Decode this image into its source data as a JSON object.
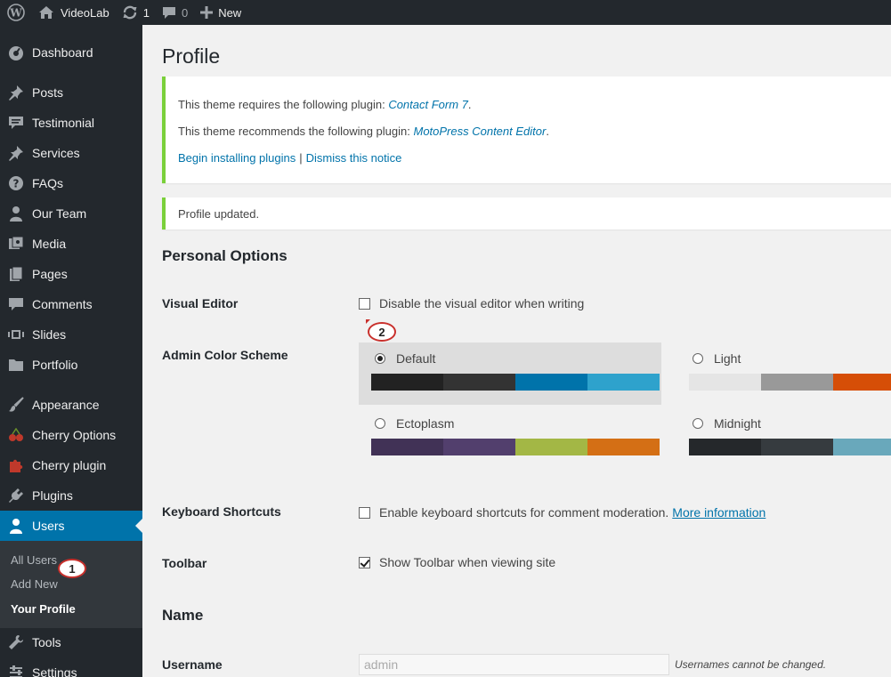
{
  "adminbar": {
    "site_name": "VideoLab",
    "updates_count": "1",
    "comments_count": "0",
    "new_label": "New",
    "icons": [
      "wordpress-logo-icon",
      "home-icon",
      "updates-icon",
      "comment-bubble-icon",
      "plus-icon"
    ]
  },
  "sidebar": {
    "items": [
      {
        "label": "Dashboard",
        "icon": "dashboard-icon"
      },
      {
        "label": "Posts",
        "icon": "pushpin-icon"
      },
      {
        "label": "Testimonial",
        "icon": "testimonial-icon"
      },
      {
        "label": "Services",
        "icon": "pushpin-icon"
      },
      {
        "label": "FAQs",
        "icon": "question-icon"
      },
      {
        "label": "Our Team",
        "icon": "person-icon"
      },
      {
        "label": "Media",
        "icon": "media-icon"
      },
      {
        "label": "Pages",
        "icon": "pages-icon"
      },
      {
        "label": "Comments",
        "icon": "comment-icon"
      },
      {
        "label": "Slides",
        "icon": "slides-icon"
      },
      {
        "label": "Portfolio",
        "icon": "folder-icon"
      },
      {
        "label": "Appearance",
        "icon": "brush-icon"
      },
      {
        "label": "Cherry Options",
        "icon": "cherry-icon"
      },
      {
        "label": "Cherry plugin",
        "icon": "puzzle-icon"
      },
      {
        "label": "Plugins",
        "icon": "plug-icon"
      },
      {
        "label": "Users",
        "icon": "user-icon"
      },
      {
        "label": "Tools",
        "icon": "wrench-icon"
      },
      {
        "label": "Settings",
        "icon": "settings-icon"
      }
    ],
    "submenu": [
      "All Users",
      "Add New",
      "Your Profile"
    ]
  },
  "main": {
    "title": "Profile",
    "notice_plugins": {
      "line1_prefix": "This theme requires the following plugin:",
      "line1_link": "Contact Form 7",
      "line2_prefix": "This theme recommends the following plugin:",
      "line2_link": "MotoPress Content Editor",
      "begin_link": "Begin installing plugins",
      "separator": "|",
      "dismiss_link": "Dismiss this notice"
    },
    "notice_updated": "Profile updated.",
    "personal_options": {
      "heading": "Personal Options",
      "visual_editor_label": "Visual Editor",
      "visual_editor_text": "Disable the visual editor when writing",
      "visual_editor_checked": false,
      "color_scheme_label": "Admin Color Scheme",
      "schemes": [
        {
          "name": "Default",
          "selected": true,
          "colors": [
            "#222222",
            "#333333",
            "#0073aa",
            "#2ea2cc"
          ]
        },
        {
          "name": "Light",
          "selected": false,
          "colors": [
            "#e5e5e5",
            "#999999",
            "#d64e07",
            "#04a4cc"
          ]
        },
        {
          "name": "Ectoplasm",
          "selected": false,
          "colors": [
            "#413256",
            "#523f6d",
            "#a3b745",
            "#d46f15"
          ]
        },
        {
          "name": "Midnight",
          "selected": false,
          "colors": [
            "#25282b",
            "#363b3f",
            "#69a8bb",
            "#e14d43"
          ]
        }
      ],
      "keyboard_label": "Keyboard Shortcuts",
      "keyboard_text": "Enable keyboard shortcuts for comment moderation.",
      "keyboard_link": "More information",
      "keyboard_checked": false,
      "toolbar_label": "Toolbar",
      "toolbar_text": "Show Toolbar when viewing site",
      "toolbar_checked": true
    },
    "name_section": {
      "heading": "Name",
      "username_label": "Username",
      "username_value": "admin",
      "username_desc": "Usernames cannot be changed."
    },
    "markers": [
      "1",
      "2"
    ]
  }
}
